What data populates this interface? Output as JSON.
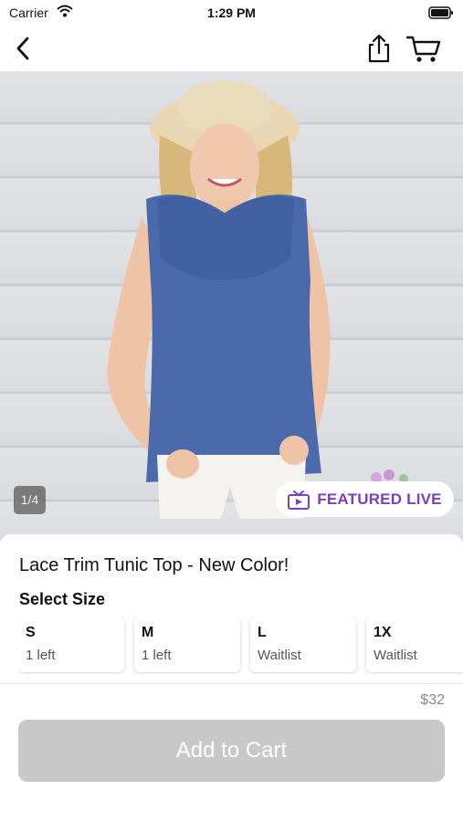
{
  "status_bar": {
    "carrier": "Carrier",
    "time": "1:29 PM"
  },
  "nav": {
    "back_icon": "chevron-left-icon",
    "share_icon": "share-icon",
    "cart_icon": "cart-icon"
  },
  "gallery": {
    "page_indicator": "1/4",
    "badge_label": "FEATURED LIVE",
    "badge_icon": "tv-icon"
  },
  "product": {
    "title": "Lace Trim Tunic Top - New Color!",
    "select_size_label": "Select Size",
    "price": "$32"
  },
  "sizes": [
    {
      "name": "S",
      "availability": "1 left"
    },
    {
      "name": "M",
      "availability": "1 left"
    },
    {
      "name": "L",
      "availability": "Waitlist"
    },
    {
      "name": "1X",
      "availability": "Waitlist"
    }
  ],
  "actions": {
    "add_to_cart": "Add to Cart"
  },
  "colors": {
    "accent": "#7b3fbf",
    "disabled_button": "#c8c8c8",
    "product": "#4a6aab"
  }
}
